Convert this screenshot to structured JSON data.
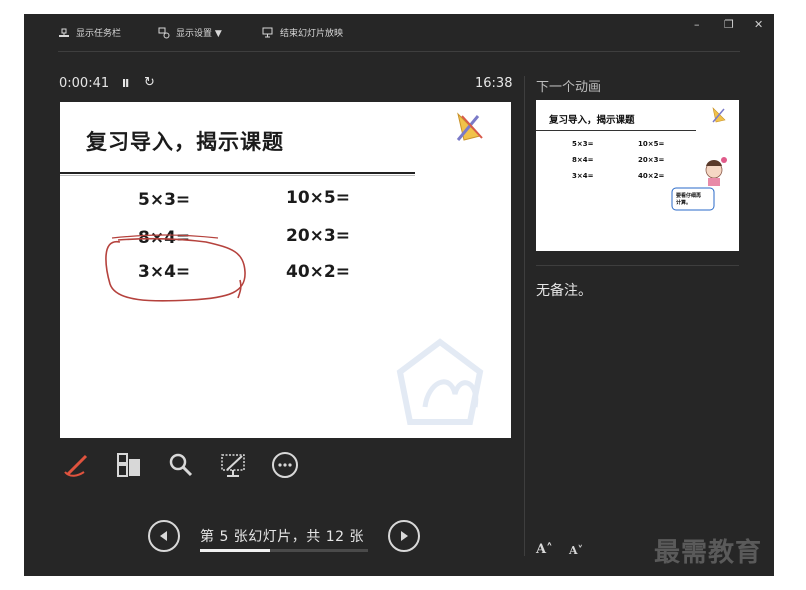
{
  "toolbar": {
    "taskbar_label": "显示任务栏",
    "display_settings_label": "显示设置 ▼",
    "end_slideshow_label": "结束幻灯片放映",
    "minimize": "–",
    "restore": "❐",
    "close": "✕"
  },
  "presenter": {
    "elapsed_time": "0:00:41",
    "pause_glyph": "II",
    "restart_glyph": "↻",
    "clock": "16:38"
  },
  "current_slide": {
    "title": "复习导入，揭示课题",
    "equations": [
      {
        "left": "5×3=",
        "right": "10×5="
      },
      {
        "left": "8×4=",
        "right": "20×3="
      },
      {
        "left": "3×4=",
        "right": "40×2="
      }
    ]
  },
  "tools": {
    "pen": "pen-tool",
    "slides": "see-all-slides",
    "zoom": "zoom",
    "screen": "black-screen",
    "more": "more-options"
  },
  "navigation": {
    "slide_label": "第 5 张幻灯片，共 12 张",
    "current": 5,
    "total": 12,
    "progress_fraction": 0.4167
  },
  "next_pane": {
    "label": "下一个动画",
    "title": "复习导入，揭示课题",
    "equations": [
      {
        "left": "5×3=",
        "right": "10×5="
      },
      {
        "left": "8×4=",
        "right": "20×3="
      },
      {
        "left": "3×4=",
        "right": "40×2="
      }
    ],
    "bubble_text": "要看仔细再\n计算。"
  },
  "notes": {
    "text": "无备注。"
  },
  "font_controls": {
    "increase": "A˄",
    "decrease": "A˅"
  },
  "watermark": "最需教育",
  "colors": {
    "background": "#262626",
    "ink_red": "#b5423d",
    "accent_pen": "#e0533e"
  }
}
